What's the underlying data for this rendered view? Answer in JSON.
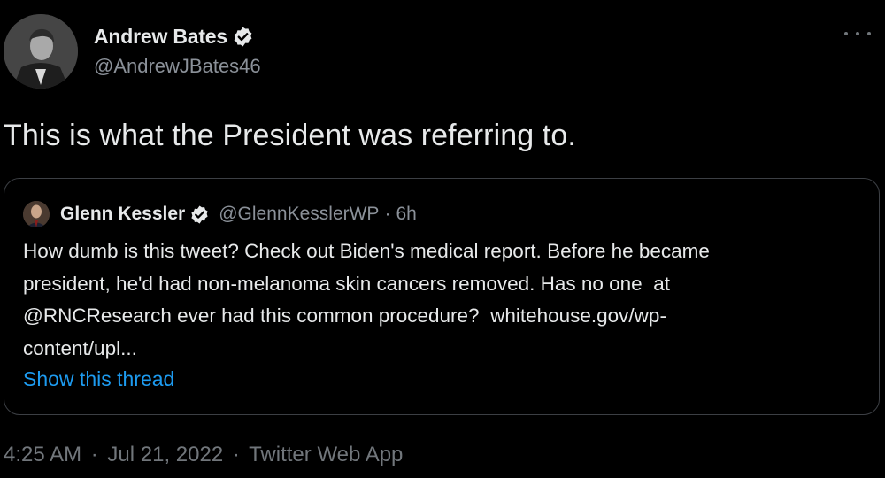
{
  "author": {
    "display_name": "Andrew Bates",
    "handle": "@AndrewJBates46",
    "verified_icon": "verified-badge-icon",
    "verified_color": "#e7e9ea"
  },
  "menu": {
    "more_icon": "more-options-icon"
  },
  "tweet": {
    "text": "This is what the President was referring to."
  },
  "quoted_tweet": {
    "display_name": "Glenn Kessler",
    "handle": "@GlennKesslerWP",
    "separator": "·",
    "time_ago": "6h",
    "text": "How dumb is this tweet? Check out Biden's medical report. Before he became\npresident, he'd had non-melanoma skin cancers removed. Has no one  at\n@RNCResearch ever had this common procedure?  whitehouse.gov/wp-\ncontent/upl...",
    "show_thread": "Show this thread"
  },
  "footer": {
    "time": "4:25 AM",
    "sep1": "·",
    "date": "Jul 21, 2022",
    "sep2": "·",
    "source": "Twitter Web App"
  },
  "colors": {
    "background": "#000000",
    "text": "#e7e9ea",
    "secondary": "#8b9199",
    "link": "#1d9bf0",
    "border": "#3c3f44"
  }
}
